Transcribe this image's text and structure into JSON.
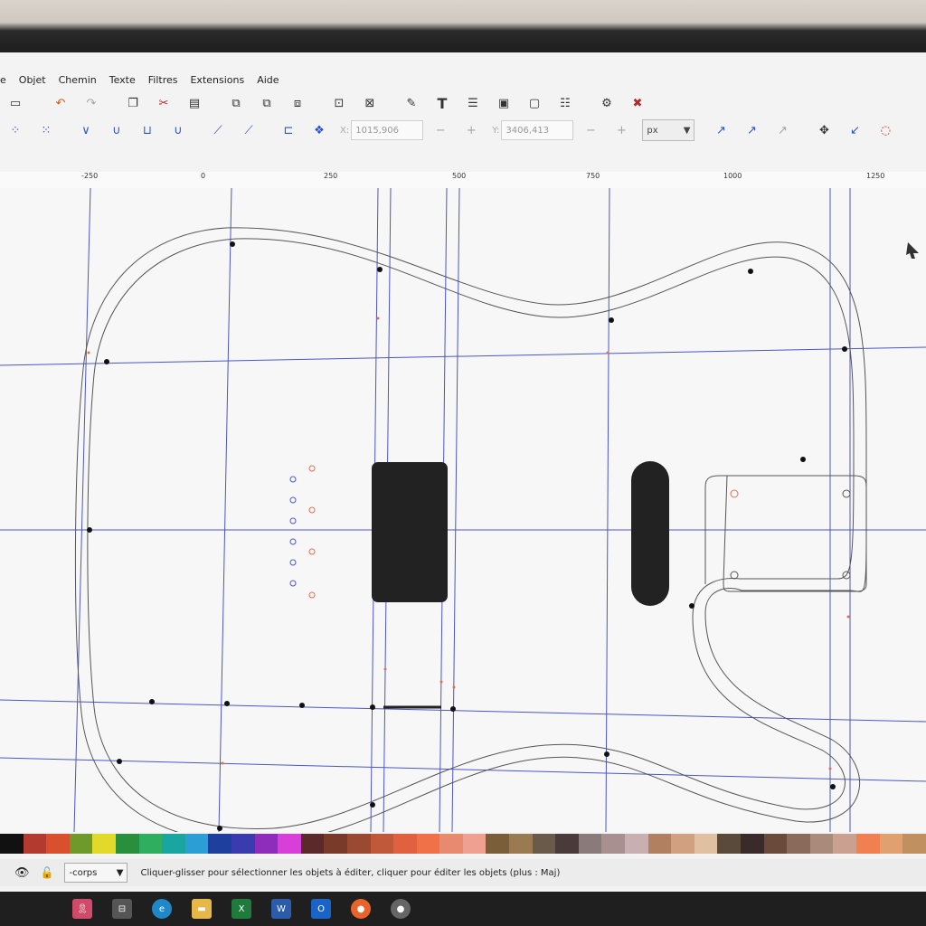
{
  "menu": {
    "items": [
      "e",
      "Objet",
      "Chemin",
      "Texte",
      "Filtres",
      "Extensions",
      "Aide"
    ]
  },
  "toolbar": {
    "x_label": "X:",
    "x_value": "1015,906",
    "y_label": "Y:",
    "y_value": "3406,413",
    "unit": "px"
  },
  "ruler": {
    "ticks": [
      "-250",
      "0",
      "250",
      "500",
      "750",
      "1000",
      "1250"
    ]
  },
  "palette": {
    "colors": [
      "#111111",
      "#b33a2e",
      "#d9502f",
      "#6e9a2c",
      "#e3d92b",
      "#2a8f3c",
      "#2fae5f",
      "#1aa6a0",
      "#2c9ed6",
      "#1f3f9e",
      "#3b3bb0",
      "#8e2dbb",
      "#d83fd8",
      "#5a2a2a",
      "#7a3a2a",
      "#9a4a30",
      "#c0583a",
      "#e06040",
      "#f07048",
      "#e88a70",
      "#f0a090",
      "#7a5e3a",
      "#9a7a50",
      "#6a5a4a",
      "#4a3a3a",
      "#8a7a7a",
      "#a89090",
      "#c8b0b0",
      "#b08060",
      "#d0a080",
      "#e0c0a0",
      "#5a4a3a",
      "#3a2a2a",
      "#6a4a3a",
      "#8a6a5a",
      "#aa8a7a",
      "#caa090",
      "#f08050",
      "#e0a070",
      "#c09060"
    ]
  },
  "status": {
    "layer": "-corps",
    "message": "Cliquer-glisser pour sélectionner les objets à éditer, cliquer pour éditer les objets (plus : Maj)"
  },
  "colors": {
    "guide": "#4b55c8",
    "outline": "#555555",
    "node": "#111111",
    "handle": "#e07050",
    "pickup": "#222222"
  }
}
